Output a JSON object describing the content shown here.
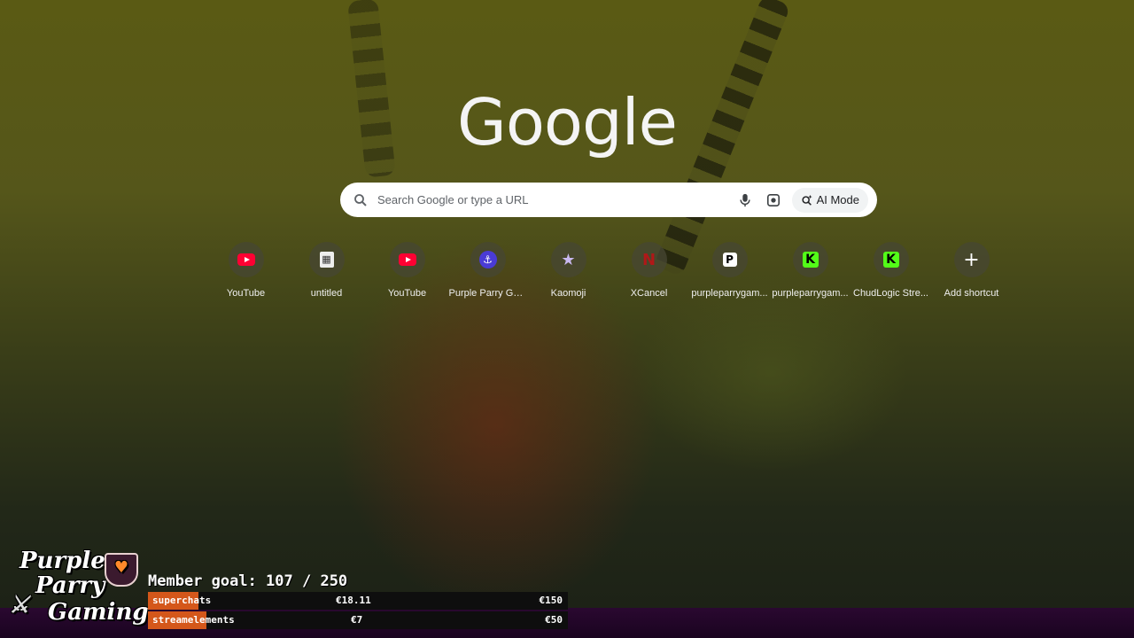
{
  "logo": {
    "text": "Google"
  },
  "search": {
    "placeholder": "Search Google or type a URL",
    "ai_mode_label": "AI Mode"
  },
  "shortcuts": [
    {
      "label": "YouTube",
      "icon": "youtube-icon"
    },
    {
      "label": "untitled",
      "icon": "document-icon"
    },
    {
      "label": "YouTube",
      "icon": "youtube-icon"
    },
    {
      "label": "Purple Parry Ga...",
      "icon": "purple-parry-icon"
    },
    {
      "label": "Kaomoji",
      "icon": "star-icon"
    },
    {
      "label": "XCancel",
      "icon": "xcancel-icon",
      "glyph": "N"
    },
    {
      "label": "purpleparrygam...",
      "icon": "patreon-icon",
      "glyph": "P"
    },
    {
      "label": "purpleparrygam...",
      "icon": "kick-icon",
      "glyph": "K"
    },
    {
      "label": "ChudLogic Stre...",
      "icon": "kick-icon",
      "glyph": "K"
    },
    {
      "label": "Add shortcut",
      "icon": "plus-icon",
      "glyph": "+"
    }
  ],
  "stream_overlay": {
    "logo_line1": "Purple",
    "logo_line2": "Parry",
    "logo_line3": "Gaming",
    "member_goal": "Member goal: 107 / 250",
    "bars": [
      {
        "label": "superchats",
        "current": "€18.11",
        "target": "€150",
        "progress": 0.12
      },
      {
        "label": "streamelements",
        "current": "€7",
        "target": "€50",
        "progress": 0.14
      }
    ],
    "bar_color": "#d4571a"
  }
}
